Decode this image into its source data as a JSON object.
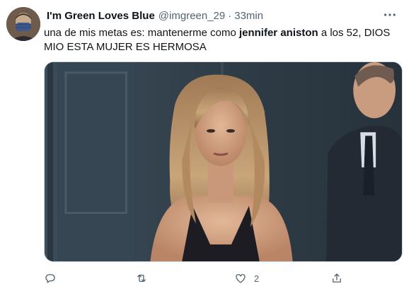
{
  "tweet": {
    "display_name": "I'm Green Loves Blue",
    "handle": "@imgreen_29",
    "separator": "·",
    "time": "33min",
    "text_part1": "una de mis metas es: mantenerme como ",
    "text_bold": "jennifer aniston",
    "text_part2": " a los 52, DIOS MIO ESTA MUJER ES HERMOSA"
  },
  "actions": {
    "like_count": "2"
  },
  "icons": {
    "more": "more-horizontal-icon",
    "reply": "reply-icon",
    "retweet": "retweet-icon",
    "like": "heart-icon",
    "share": "share-icon"
  },
  "colors": {
    "text": "#0f1419",
    "secondary": "#536471",
    "border": "#cfd9de"
  }
}
